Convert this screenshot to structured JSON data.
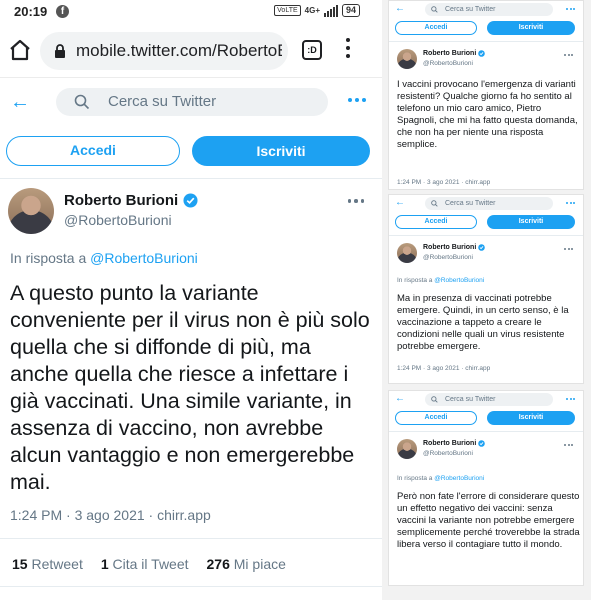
{
  "statusbar": {
    "time": "20:19",
    "app_badge": "f",
    "volte": "VoLTE",
    "signal": "4G+",
    "battery": "94"
  },
  "browser": {
    "url": "mobile.twitter.com/RobertoB",
    "tab_count": ":D"
  },
  "twitter_header": {
    "search_placeholder": "Cerca su Twitter"
  },
  "auth": {
    "login_label": "Accedi",
    "signup_label": "Iscriviti"
  },
  "main_tweet": {
    "author_name": "Roberto Burioni",
    "author_handle": "@RobertoBurioni",
    "reply_prefix": "In risposta a",
    "reply_mention": "@RobertoBurioni",
    "text": "A questo punto la variante conveniente per il virus non è più solo quella che si diffonde di più, ma anche quella che riesce a infettare i già vaccinati. Una simile variante, in assenza di vaccino, non avrebbe alcun vantaggio e non emergerebbe mai.",
    "meta": "1:24 PM · 3 ago 2021 · chirr.app",
    "stats": {
      "retweets_count": "15",
      "retweets_label": "Retweet",
      "quotes_count": "1",
      "quotes_label": "Cita il Tweet",
      "likes_count": "276",
      "likes_label": "Mi piace"
    }
  },
  "mini_tweets": [
    {
      "search_placeholder": "Cerca su Twitter",
      "login_label": "Accedi",
      "signup_label": "Iscriviti",
      "author_name": "Roberto Burioni",
      "author_handle": "@RobertoBurioni",
      "text": "I vaccini provocano l'emergenza di varianti resistenti? Qualche giorno fa ho sentito al telefono un mio caro amico, Pietro Spagnoli, che mi ha fatto questa domanda, che non ha per niente una risposta semplice.",
      "meta": "1:24 PM · 3 ago 2021 · chirr.app"
    },
    {
      "search_placeholder": "Cerca su Twitter",
      "login_label": "Accedi",
      "signup_label": "Iscriviti",
      "author_name": "Roberto Burioni",
      "author_handle": "@RobertoBurioni",
      "reply_prefix": "In risposta a",
      "reply_mention": "@RobertoBurioni",
      "text": "Ma in presenza di vaccinati potrebbe emergere. Quindi, in un certo senso, è la vaccinazione a tappeto a creare le condizioni nelle quali un virus resistente potrebbe emergere.",
      "meta": "1:24 PM · 3 ago 2021 · chirr.app"
    },
    {
      "search_placeholder": "Cerca su Twitter",
      "login_label": "Accedi",
      "signup_label": "Iscriviti",
      "author_name": "Roberto Burioni",
      "author_handle": "@RobertoBurioni",
      "reply_prefix": "In risposta a",
      "reply_mention": "@RobertoBurioni",
      "text": "Però non fate l'errore di considerare questo un effetto negativo dei vaccini: senza vaccini la variante non potrebbe emergere semplicemente perché troverebbe la strada libera verso il contagiare tutto il mondo.",
      "meta": ""
    }
  ],
  "colors": {
    "twitter_blue": "#1da1f2",
    "text_primary": "#14171a",
    "text_secondary": "#657786"
  }
}
